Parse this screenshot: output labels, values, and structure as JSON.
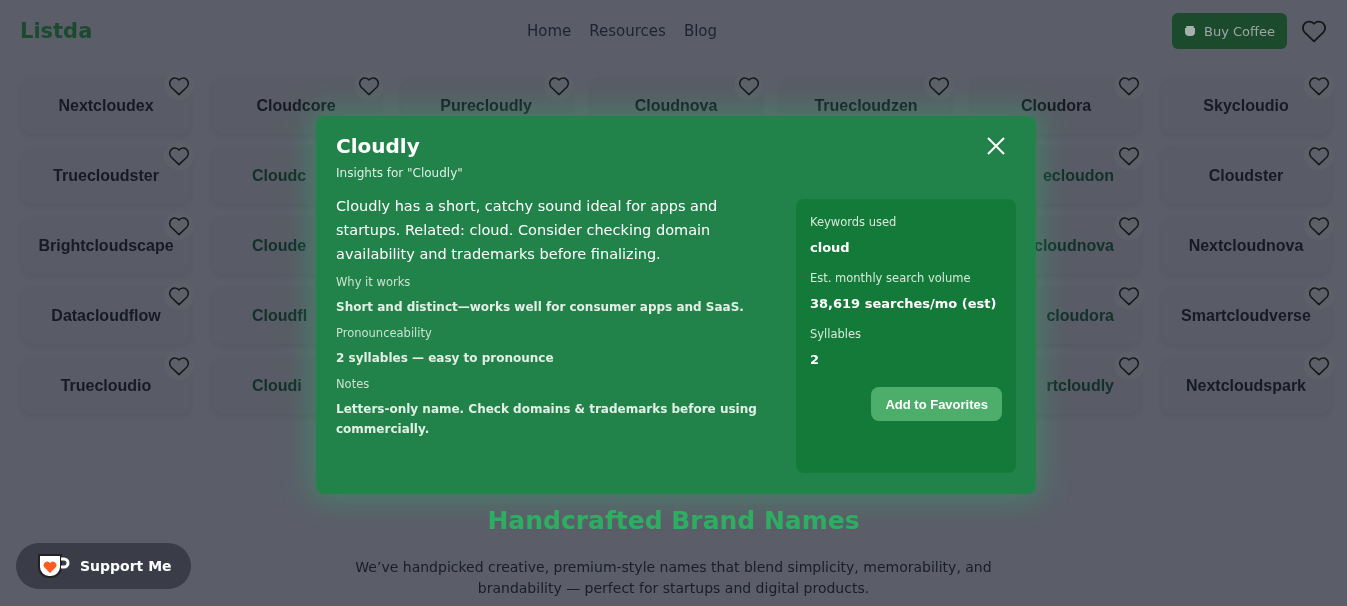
{
  "header": {
    "logo": "Listda",
    "nav": [
      {
        "label": "Home"
      },
      {
        "label": "Resources"
      },
      {
        "label": "Blog"
      }
    ],
    "buy_button": "Buy Coffee"
  },
  "name_grid": [
    [
      {
        "name": "Nextcloudex",
        "kind": "full"
      },
      {
        "name": "Cloudcore",
        "kind": "full"
      },
      {
        "name": "Purecloudly",
        "kind": "full"
      },
      {
        "name": "Cloudnova",
        "kind": "full"
      },
      {
        "name": "Truecloudzen",
        "kind": "full"
      },
      {
        "name": "Cloudora",
        "kind": "full"
      },
      {
        "name": "Skycloudio",
        "kind": "full"
      }
    ],
    [
      {
        "name": "Truecloudster",
        "kind": "full"
      },
      {
        "name": "Cloudc",
        "kind": "clipped_end"
      },
      {
        "name": "ecloudon",
        "kind": "clipped_start"
      },
      {
        "name": "Cloudster",
        "kind": "full"
      }
    ],
    [
      {
        "name": "Brightcloudscape",
        "kind": "full"
      },
      {
        "name": "Cloude",
        "kind": "clipped_end"
      },
      {
        "name": "cloudnova",
        "kind": "clipped_start"
      },
      {
        "name": "Nextcloudnova",
        "kind": "full"
      }
    ],
    [
      {
        "name": "Datacloudflow",
        "kind": "full"
      },
      {
        "name": "Cloudfl",
        "kind": "clipped_end"
      },
      {
        "name": "cloudora",
        "kind": "clipped_start"
      },
      {
        "name": "Smartcloudverse",
        "kind": "full"
      }
    ],
    [
      {
        "name": "Truecloudio",
        "kind": "full"
      },
      {
        "name": "Cloudi",
        "kind": "clipped_end"
      },
      {
        "name": "rtcloudly",
        "kind": "clipped_start"
      },
      {
        "name": "Nextcloudspark",
        "kind": "full"
      }
    ]
  ],
  "modal": {
    "title": "Cloudly",
    "subtitle": "Insights for \"Cloudly\"",
    "description": "Cloudly has a short, catchy sound ideal for apps and startups. Related: cloud. Consider checking domain availability and trademarks before finalizing.",
    "sections": [
      {
        "label": "Why it works",
        "value": "Short and distinct—works well for consumer apps and SaaS."
      },
      {
        "label": "Pronounceability",
        "value": "2 syllables — easy to pronounce"
      },
      {
        "label": "Notes",
        "value": "Letters-only name. Check domains & trademarks before using commercially."
      }
    ],
    "stats": [
      {
        "label": "Keywords used",
        "value": "cloud"
      },
      {
        "label": "Est. monthly search volume",
        "value": "38,619 searches/mo (est)"
      },
      {
        "label": "Syllables",
        "value": "2"
      }
    ],
    "add_button": "Add to Favorites"
  },
  "section": {
    "heading": "Handcrafted Brand Names",
    "text": "We’ve handpicked creative, premium-style names that blend simplicity, memorability, and brandability — perfect for startups and digital products."
  },
  "support_button": "Support Me"
}
